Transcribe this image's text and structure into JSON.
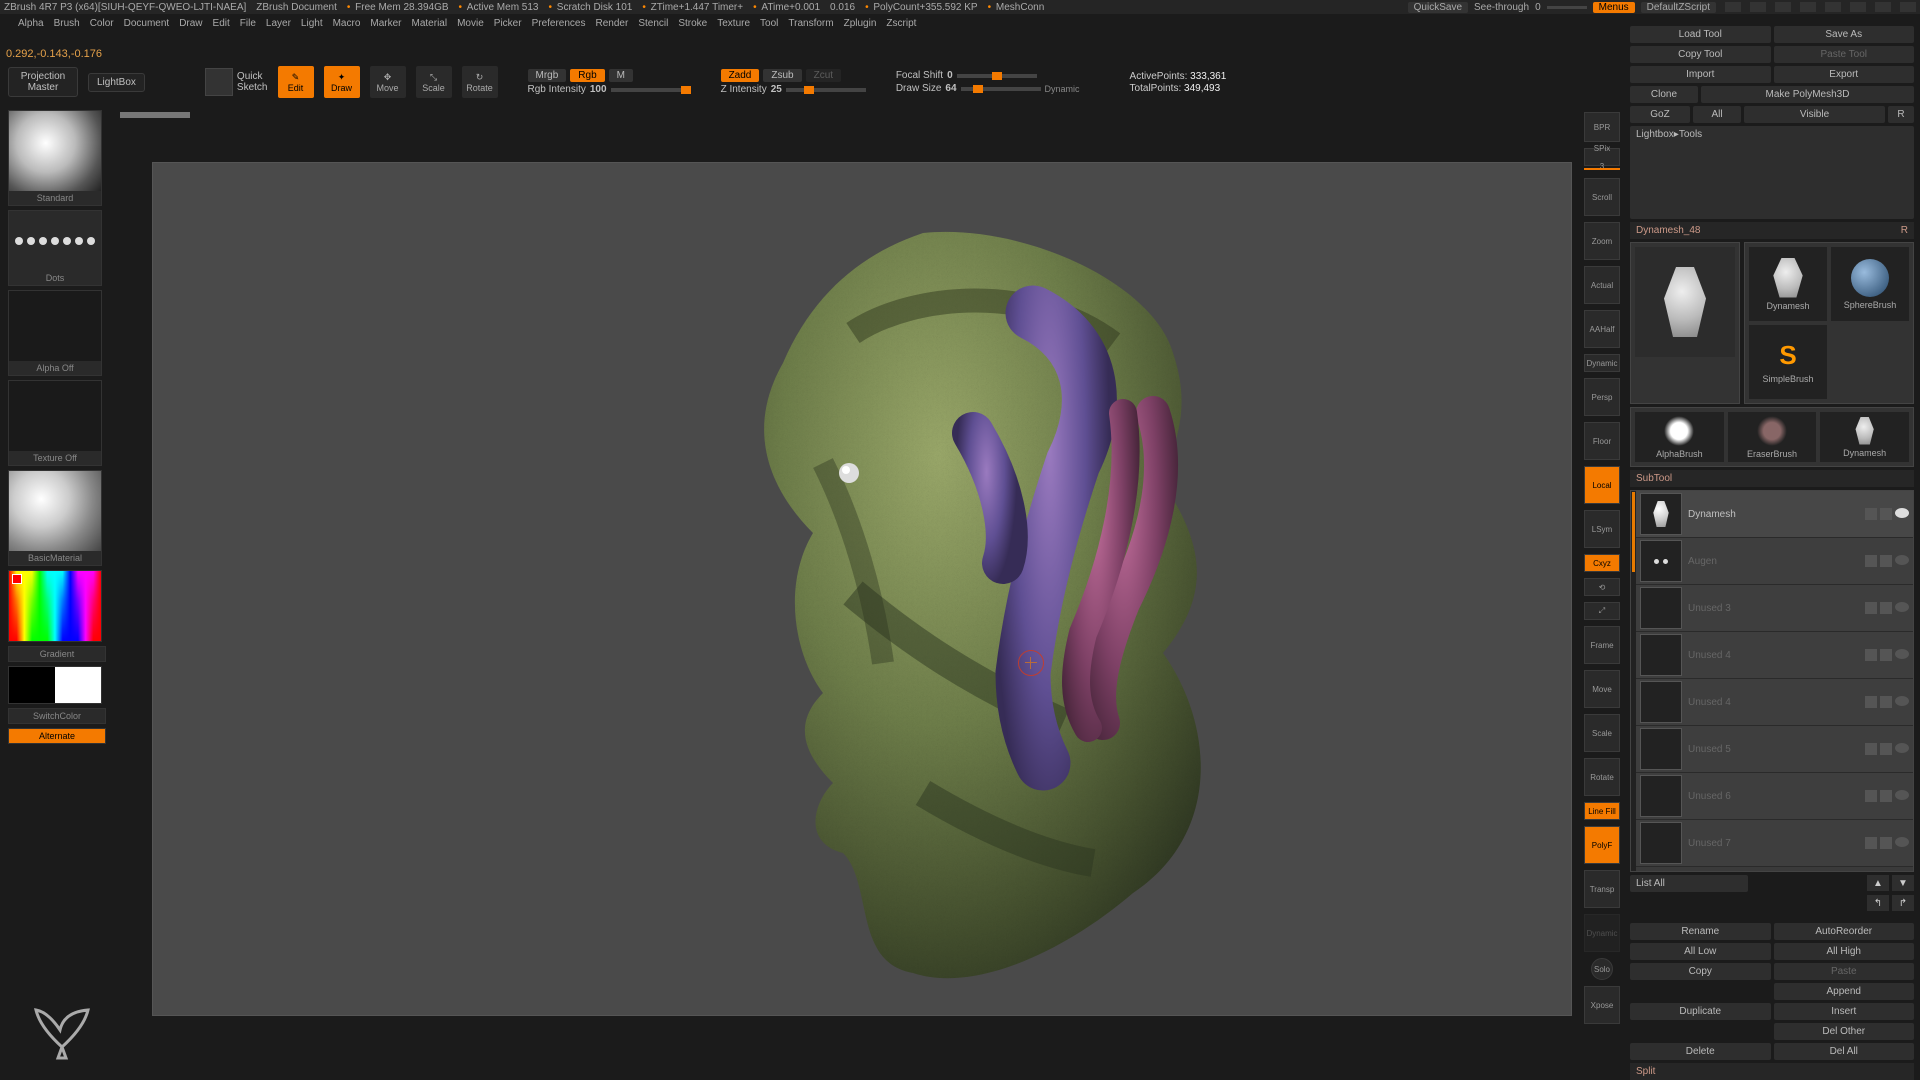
{
  "titlebar": {
    "app": "ZBrush 4R7 P3 (x64)[SIUH-QEYF-QWEO-LJTI-NAEA]",
    "doc": "ZBrush Document",
    "mem": "Free Mem 28.394GB",
    "activemem": "Active Mem 513",
    "scratch": "Scratch Disk 101",
    "ztime": "ZTime+1.447  Timer+",
    "atime": "ATime+0.001",
    "atimeval": "0.016",
    "polycount": "PolyCount+355.592 KP",
    "mesh": "MeshConn",
    "quicksave": "QuickSave",
    "seethrough_label": "See-through",
    "seethrough_val": "0",
    "menus": "Menus",
    "script": "DefaultZScript"
  },
  "menus": [
    "Alpha",
    "Brush",
    "Color",
    "Document",
    "Draw",
    "Edit",
    "File",
    "Layer",
    "Light",
    "Macro",
    "Marker",
    "Material",
    "Movie",
    "Picker",
    "Preferences",
    "Render",
    "Stencil",
    "Stroke",
    "Texture",
    "Tool",
    "Transform",
    "Zplugin",
    "Zscript"
  ],
  "status_coords": "0.292,-0.143,-0.176",
  "shelf": {
    "projection": "Projection\nMaster",
    "lightbox": "LightBox",
    "quicksketch": "Quick\nSketch",
    "edit": "Edit",
    "draw": "Draw",
    "move": "Move",
    "scale": "Scale",
    "rotate": "Rotate",
    "mrgb": "Mrgb",
    "rgb": "Rgb",
    "m": "M",
    "rgbint_label": "Rgb Intensity",
    "rgbint_val": "100",
    "zadd": "Zadd",
    "zsub": "Zsub",
    "zcut": "Zcut",
    "zint_label": "Z Intensity",
    "zint_val": "25",
    "focal_label": "Focal Shift",
    "focal_val": "0",
    "draw_label": "Draw Size",
    "draw_val": "64",
    "dynamic": "Dynamic",
    "active_label": "ActivePoints:",
    "active_val": "333,361",
    "total_label": "TotalPoints:",
    "total_val": "349,493"
  },
  "left": {
    "brush": "Standard",
    "stroke": "Dots",
    "alpha": "Alpha Off",
    "texture": "Texture Off",
    "material": "BasicMaterial",
    "gradient": "Gradient",
    "switch": "SwitchColor",
    "alternate": "Alternate"
  },
  "rightcol": {
    "bpr": "BPR",
    "spix_label": "SPix",
    "spix_val": "3",
    "items": [
      "Scroll",
      "Zoom",
      "Actual",
      "AAHalf",
      "Dynamic",
      "Persp",
      "Floor",
      "Local",
      "LSym",
      "Cxyz",
      "",
      "",
      "Frame",
      "Move",
      "Scale",
      "Rotate",
      "Line Fill",
      "PolyF",
      "Transp",
      "Dynamic",
      "Solo",
      "Xpose"
    ]
  },
  "tool": {
    "load": "Load Tool",
    "save": "Save As",
    "copy": "Copy Tool",
    "paste": "Paste Tool",
    "import": "Import",
    "export": "Export",
    "clone": "Clone",
    "makepm": "Make PolyMesh3D",
    "goz": "GoZ",
    "all": "All",
    "visible": "Visible",
    "r": "R",
    "lb": "Lightbox▸Tools",
    "dmtitle": "Dynamesh_48",
    "dmtitleR": "R",
    "cells": [
      "Dynamesh",
      "SphereBrush",
      "SimpleBrush",
      "AlphaBrush",
      "EraserBrush",
      "Dynamesh"
    ],
    "subtool": "SubTool",
    "st_rows": [
      {
        "name": "Dynamesh",
        "dim": false,
        "thumb": "torso",
        "eye": true
      },
      {
        "name": "Augen",
        "dim": true,
        "thumb": "dots",
        "eye": false
      },
      {
        "name": "Unused 3",
        "dim": true,
        "thumb": "",
        "eye": false
      },
      {
        "name": "Unused 4",
        "dim": true,
        "thumb": "",
        "eye": false
      },
      {
        "name": "Unused 4",
        "dim": true,
        "thumb": "",
        "eye": false
      },
      {
        "name": "Unused 5",
        "dim": true,
        "thumb": "",
        "eye": false
      },
      {
        "name": "Unused 6",
        "dim": true,
        "thumb": "",
        "eye": false
      },
      {
        "name": "Unused 7",
        "dim": true,
        "thumb": "",
        "eye": false
      }
    ],
    "listall": "List All",
    "up": "▲",
    "down": "▼",
    "in": "↰",
    "out": "↱",
    "rename": "Rename",
    "autoreorder": "AutoReorder",
    "alllow": "All Low",
    "allhigh": "All High",
    "copy2": "Copy",
    "paste2": "Paste",
    "append": "Append",
    "duplicate": "Duplicate",
    "insert": "Insert",
    "delete": "Delete",
    "delother": "Del Other",
    "delall": "Del All",
    "split": "Split"
  }
}
